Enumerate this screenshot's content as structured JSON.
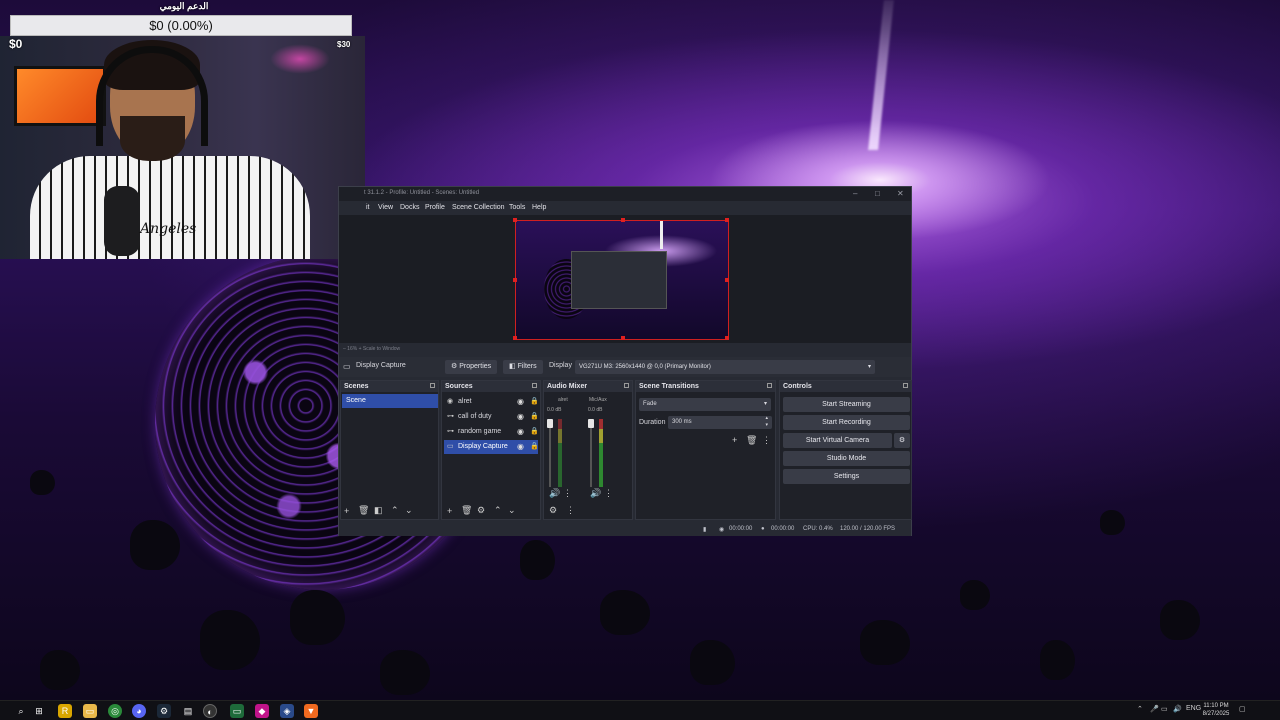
{
  "donation": {
    "title": "الدعم اليومي",
    "bar_text": "$0 (0.00%)",
    "current": "$0",
    "goal": "$30",
    "progress_percent": 0
  },
  "webcam": {
    "shirt_text": "Angeles"
  },
  "obs": {
    "title": "t 31.1.2 - Profile: Untitled - Scenes: Untitled",
    "menu": [
      "it",
      "View",
      "Docks",
      "Profile",
      "Scene Collection",
      "Tools",
      "Help"
    ],
    "zoom": "–   16%   +   Scale to Window",
    "context": {
      "source_name": "Display Capture",
      "properties": "Properties",
      "filters": "Filters",
      "display_label": "Display",
      "display_value": "VG271U M3: 2560x1440 @ 0,0 (Primary Monitor)"
    },
    "docks": {
      "scenes": {
        "title": "Scenes",
        "items": [
          "Scene"
        ]
      },
      "sources": {
        "title": "Sources",
        "items": [
          {
            "name": "alret",
            "icon": "globe-icon"
          },
          {
            "name": "call of duty",
            "icon": "gamepad-icon"
          },
          {
            "name": "random game",
            "icon": "gamepad-icon"
          },
          {
            "name": "Display Capture",
            "icon": "monitor-icon"
          }
        ]
      },
      "mixer": {
        "title": "Audio Mixer",
        "channels": [
          {
            "name": "alret",
            "db": "0.0 dB",
            "level": 0
          },
          {
            "name": "Mic/Aux",
            "db": "0.0 dB",
            "level": 0.35
          }
        ],
        "scale": [
          "0",
          "-5",
          "-10",
          "-15",
          "-20",
          "-25",
          "-30",
          "-35",
          "-40",
          "-45",
          "-50",
          "-55",
          "-60"
        ]
      },
      "transitions": {
        "title": "Scene Transitions",
        "selected": "Fade",
        "duration_label": "Duration",
        "duration_value": "300 ms"
      },
      "controls": {
        "title": "Controls",
        "buttons": [
          "Start Streaming",
          "Start Recording",
          "Start Virtual Camera",
          "Studio Mode",
          "Settings"
        ]
      }
    },
    "status": {
      "stream_time": "00:00:00",
      "rec_time": "00:00:00",
      "cpu": "CPU: 0.4%",
      "fps": "120.00 / 120.00 FPS"
    }
  },
  "taskbar": {
    "lang": "ENG",
    "time": "11:10 PM",
    "date": "8/27/2025",
    "apps": [
      "search-icon",
      "task-view-icon",
      "app-icon",
      "file-explorer-icon",
      "chrome-icon",
      "discord-icon",
      "steam-icon",
      "app-icon",
      "obs-icon",
      "terminal-icon",
      "app-icon",
      "vpn-icon",
      "brave-icon"
    ]
  }
}
